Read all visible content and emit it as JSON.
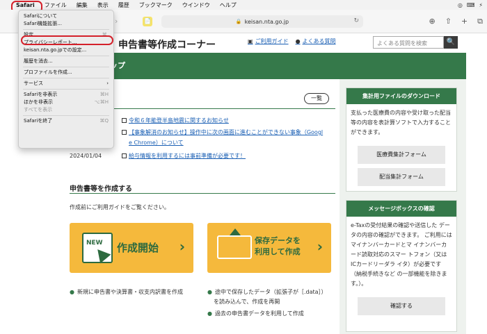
{
  "menubar": {
    "apple": "",
    "items": [
      "Safari",
      "ファイル",
      "編集",
      "表示",
      "履歴",
      "ブックマーク",
      "ウインドウ",
      "ヘルプ"
    ],
    "right_icons": [
      "◎",
      "⌨",
      "⚡"
    ]
  },
  "browser": {
    "url": "keisan.nta.go.jp",
    "lock": "🔒",
    "reload": "↻",
    "forward": "›",
    "favicon": "📄",
    "toolbar_icons": [
      "⊕",
      "⇧",
      "+",
      "⧉"
    ]
  },
  "site": {
    "title": "申告書等作成コーナー",
    "guide_link": "ご利用ガイド",
    "faq_link": "よくある質問",
    "search_placeholder": "よくある質問を検索",
    "search_btn": "🔍",
    "band_text": "ップ"
  },
  "news": {
    "list_button": "一覧",
    "items": [
      {
        "date": "",
        "text": "令和６年能登半島地震に関するお知らせ"
      },
      {
        "date": "",
        "text": "【事象解消のお知らせ】操作中に次の画面に進むことができない事象（Googl"
      },
      {
        "date": "",
        "text": "e Chrome）について"
      },
      {
        "date": "2024/01/04",
        "text": "給与情報を利用するには事前準備が必要です！"
      }
    ]
  },
  "create": {
    "title": "申告書等を作成する",
    "desc": "作成前にご利用ガイドをご覧ください。",
    "start_label": "作成開始",
    "new_badge": "NEW",
    "resume_label_1": "保存データを",
    "resume_label_2": "利用して作成",
    "chevron": "›",
    "start_bullets": [
      "新規に申告書や決算書・収支内訳書を作成"
    ],
    "resume_bullets": [
      "途中で保存したデータ（拡張子が［.data］）",
      "を読み込んで、作成を再開",
      "過去の申告書データを利用して作成"
    ]
  },
  "sidebar": {
    "download_head": "集計用ファイルのダウンロード",
    "download_text": "支払った医療費の内容や受け取った配当等の内容を表計算ソフトで入力することができます。",
    "medical_btn": "医療費集計フォーム",
    "dividend_btn": "配当集計フォーム",
    "message_head": "メッセージボックスの確認",
    "message_text": "e-Taxの受付結果の確認や送信した データの内容の確認ができます。 ご利用にはマイナンバーカードとマ イナンバーカード読取対応のスマー トフォン（又はICカードリーダラ イタ）が必要です（納税手続きなど の一部機能を除きます。）。",
    "confirm_btn": "確認する"
  },
  "safari_menu": {
    "items": [
      {
        "label": "Safariについて",
        "shortcut": ""
      },
      {
        "label": "Safari機能拡張...",
        "shortcut": ""
      },
      {
        "label": "設定...",
        "shortcut": "⌘,"
      },
      {
        "label": "プライバシーレポート...",
        "shortcut": ""
      },
      {
        "label": "keisan.nta.go.jpでの設定...",
        "shortcut": ""
      },
      {
        "label": "履歴を消去...",
        "shortcut": ""
      },
      {
        "label": "プロファイルを作成...",
        "shortcut": ""
      },
      {
        "label": "サービス",
        "shortcut": "›"
      },
      {
        "label": "Safariを非表示",
        "shortcut": "⌘H"
      },
      {
        "label": "ほかを非表示",
        "shortcut": "⌥⌘H"
      },
      {
        "label": "すべてを表示",
        "shortcut": ""
      },
      {
        "label": "Safariを終了",
        "shortcut": "⌘Q"
      }
    ]
  },
  "colors": {
    "accent_green": "#35794a",
    "button_orange": "#f5b93c",
    "highlight_red": "#d4202a",
    "link_blue": "#1a5fb4"
  }
}
